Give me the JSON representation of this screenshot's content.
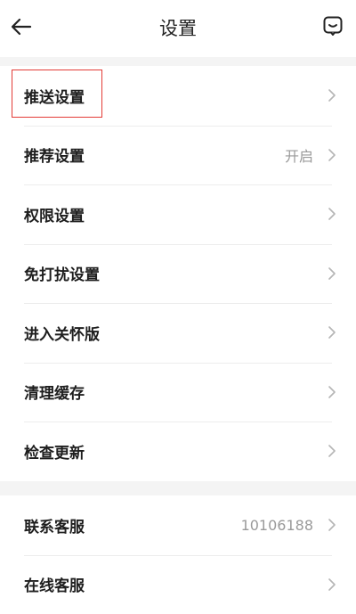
{
  "header": {
    "title": "设置",
    "back_icon": "back-arrow-icon",
    "feedback_icon": "feedback-chat-icon"
  },
  "group1": {
    "items": [
      {
        "label": "推送设置",
        "value": ""
      },
      {
        "label": "推荐设置",
        "value": "开启"
      },
      {
        "label": "权限设置",
        "value": ""
      },
      {
        "label": "免打扰设置",
        "value": ""
      },
      {
        "label": "进入关怀版",
        "value": ""
      },
      {
        "label": "清理缓存",
        "value": ""
      },
      {
        "label": "检查更新",
        "value": ""
      }
    ]
  },
  "group2": {
    "items": [
      {
        "label": "联系客服",
        "value": "10106188"
      },
      {
        "label": "在线客服",
        "value": ""
      }
    ]
  },
  "colors": {
    "highlight": "#e33b36",
    "text_primary": "#1e1e1e",
    "text_secondary": "#9a9a9a",
    "background": "#f4f4f4"
  }
}
